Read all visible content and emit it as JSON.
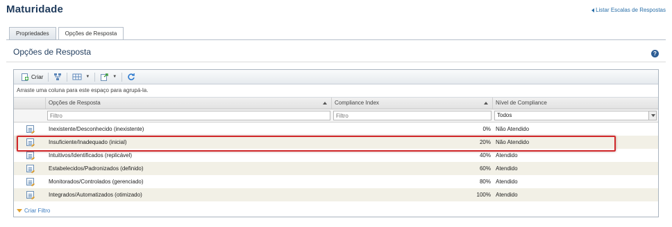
{
  "page": {
    "title": "Maturidade",
    "back_link": "Listar Escalas de Respostas"
  },
  "tabs": [
    {
      "label": "Propriedades"
    },
    {
      "label": "Opções de Resposta"
    }
  ],
  "section": {
    "title": "Opções de Resposta",
    "help": "?"
  },
  "toolbar": {
    "create_label": "Criar"
  },
  "grid": {
    "group_hint": "Arraste uma coluna para este espaço para agrupá-la.",
    "columns": [
      "Opções de Resposta",
      "Compliance Index",
      "Nível de Compliance"
    ],
    "filters": {
      "name_placeholder": "Filtro",
      "compliance_placeholder": "Filtro",
      "nivel_value": "Todos"
    },
    "rows": [
      {
        "name": "Inexistente/Desconhecido (inexistente)",
        "compliance": "0%",
        "nivel": "Não Atendido"
      },
      {
        "name": "Insuficiente/Inadequado (inicial)",
        "compliance": "20%",
        "nivel": "Não Atendido"
      },
      {
        "name": "Intuitivos/Identificados (replicável)",
        "compliance": "40%",
        "nivel": "Atendido"
      },
      {
        "name": "Estabelecidos/Padronizados (definido)",
        "compliance": "60%",
        "nivel": "Atendido"
      },
      {
        "name": "Monitorados/Controlados (gerenciado)",
        "compliance": "80%",
        "nivel": "Atendido"
      },
      {
        "name": "Integrados/Automatizados (otimizado)",
        "compliance": "100%",
        "nivel": "Atendido"
      }
    ],
    "footer_label": "Criar Filtro"
  }
}
